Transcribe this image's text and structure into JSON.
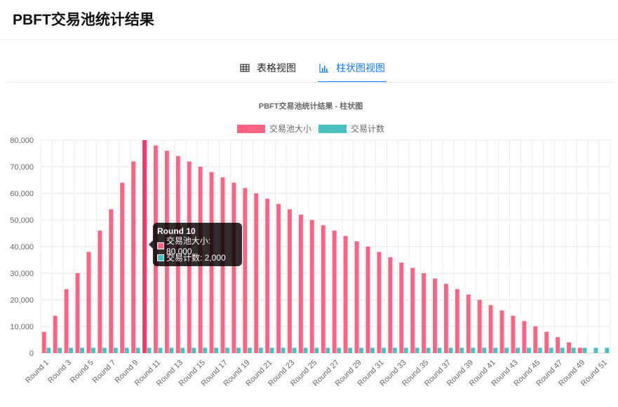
{
  "page": {
    "title": "PBFT交易池统计结果"
  },
  "tabs": [
    {
      "label": "表格视图",
      "icon": "table-icon",
      "active": false
    },
    {
      "label": "柱状图视图",
      "icon": "bar-chart-icon",
      "active": true
    }
  ],
  "colors": {
    "accent": "#1677ff",
    "series_pool": "#ff6384",
    "series_count": "#4bc0c0"
  },
  "tooltip": {
    "title": "Round 10",
    "rows": [
      {
        "label": "交易池大小: 80,000"
      },
      {
        "label": "交易计数: 2,000"
      }
    ]
  },
  "chart_data": {
    "type": "bar",
    "title": "PBFT交易池统计结果 - 柱状图",
    "legend_position": "top",
    "grid": true,
    "ylim": [
      0,
      80000
    ],
    "yticks": [
      "0",
      "10,000",
      "20,000",
      "30,000",
      "40,000",
      "50,000",
      "60,000",
      "70,000",
      "80,000"
    ],
    "categories": [
      "Round 1",
      "Round 2",
      "Round 3",
      "Round 4",
      "Round 5",
      "Round 6",
      "Round 7",
      "Round 8",
      "Round 9",
      "Round 10",
      "Round 11",
      "Round 12",
      "Round 13",
      "Round 14",
      "Round 15",
      "Round 16",
      "Round 17",
      "Round 18",
      "Round 19",
      "Round 20",
      "Round 21",
      "Round 22",
      "Round 23",
      "Round 24",
      "Round 25",
      "Round 26",
      "Round 27",
      "Round 28",
      "Round 29",
      "Round 30",
      "Round 31",
      "Round 32",
      "Round 33",
      "Round 34",
      "Round 35",
      "Round 36",
      "Round 37",
      "Round 38",
      "Round 39",
      "Round 40",
      "Round 41",
      "Round 42",
      "Round 43",
      "Round 44",
      "Round 45",
      "Round 46",
      "Round 47",
      "Round 48",
      "Round 49",
      "Round 50",
      "Round 51"
    ],
    "series": [
      {
        "name": "交易池大小",
        "color": "#ff6384",
        "values": [
          8000,
          14000,
          24000,
          30000,
          38000,
          46000,
          54000,
          64000,
          72000,
          80000,
          78000,
          76000,
          74000,
          72000,
          70000,
          68000,
          66000,
          64000,
          62000,
          60000,
          58000,
          56000,
          54000,
          52000,
          50000,
          48000,
          46000,
          44000,
          42000,
          40000,
          38000,
          36000,
          34000,
          32000,
          30000,
          28000,
          26000,
          24000,
          22000,
          20000,
          18000,
          16000,
          14000,
          12000,
          10000,
          8000,
          6000,
          4000,
          2000,
          0,
          0
        ]
      },
      {
        "name": "交易计数",
        "color": "#4bc0c0",
        "values": [
          2000,
          2000,
          2000,
          2000,
          2000,
          2000,
          2000,
          2000,
          2000,
          2000,
          2000,
          2000,
          2000,
          2000,
          2000,
          2000,
          2000,
          2000,
          2000,
          2000,
          2000,
          2000,
          2000,
          2000,
          2000,
          2000,
          2000,
          2000,
          2000,
          2000,
          2000,
          2000,
          2000,
          2000,
          2000,
          2000,
          2000,
          2000,
          2000,
          2000,
          2000,
          2000,
          2000,
          2000,
          2000,
          2000,
          2000,
          2000,
          2000,
          2000,
          2000
        ]
      }
    ],
    "highlight_index": 9
  }
}
